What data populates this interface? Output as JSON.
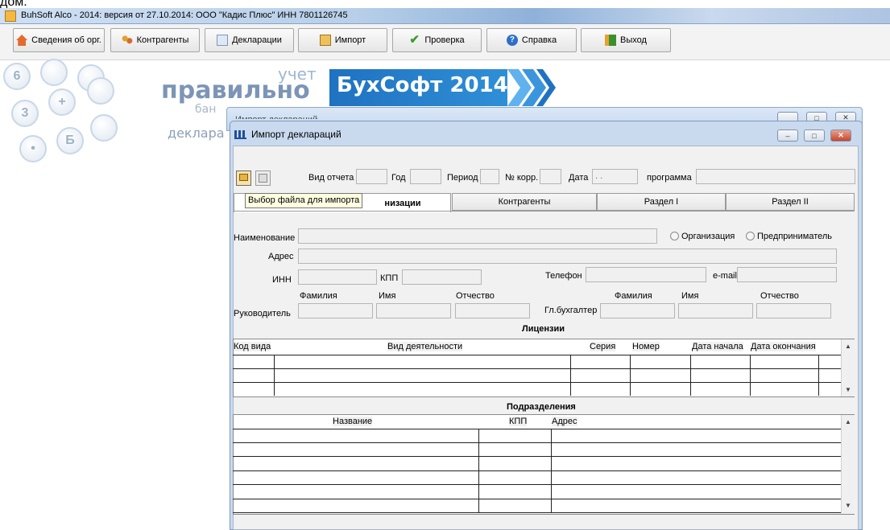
{
  "top_cut_text": "дом.",
  "app": {
    "title": "BuhSoft Alco - 2014: версия от 27.10.2014: ООО \"Кадис Плюс\" ИНН 7801126745"
  },
  "toolbar": {
    "buttons": [
      {
        "label": "Сведения об орг.",
        "icon": "home-icon"
      },
      {
        "label": "Контрагенты",
        "icon": "contacts-icon"
      },
      {
        "label": "Декларации",
        "icon": "document-icon"
      },
      {
        "label": "Импорт",
        "icon": "import-icon"
      },
      {
        "label": "Проверка",
        "icon": "checkmark-icon"
      },
      {
        "label": "Справка",
        "icon": "help-icon"
      },
      {
        "label": "Выход",
        "icon": "exit-icon"
      }
    ]
  },
  "banner": {
    "title": "БухСофт 2014",
    "word1": "правильно",
    "word2": "учет",
    "word3": "бан",
    "word4": "деклара",
    "keys": [
      "6",
      "+",
      "3",
      "Б",
      "•"
    ]
  },
  "bg_window": {
    "title": "Импорт деклараций"
  },
  "dialog": {
    "title": "Импорт деклараций",
    "tooltip": "Выбор файла для импорта",
    "header_fields": {
      "vid_otcheta": "Вид отчета",
      "god": "Год",
      "period": "Период",
      "korr": "№ корр.",
      "data": "Дата",
      "data_value": " . .",
      "programma": "программа"
    },
    "tabs": [
      {
        "label": "низации",
        "active": true
      },
      {
        "label": "Контрагенты",
        "active": false
      },
      {
        "label": "Раздел I",
        "active": false
      },
      {
        "label": "Раздел II",
        "active": false
      }
    ],
    "form": {
      "naimenovanie": "Наименование",
      "adres": "Адрес",
      "inn": "ИНН",
      "kpp": "КПП",
      "telefon": "Телефон",
      "email": "e-mail",
      "familiya": "Фамилия",
      "imya": "Имя",
      "otchestvo": "Отчество",
      "rukovoditel": "Руководитель",
      "glbuh": "Гл.бухгалтер",
      "radio_org": "Организация",
      "radio_ip": "Предприниматель"
    },
    "licenses": {
      "title": "Лицензии",
      "columns": [
        "Код вида",
        "Вид деятельности",
        "Серия",
        "Номер",
        "Дата начала",
        "Дата окончания"
      ]
    },
    "subdivisions": {
      "title": "Подразделения",
      "columns": [
        "Название",
        "КПП",
        "Адрес"
      ]
    }
  },
  "colors": {
    "banner_blue": "#1f72c1",
    "dialog_frame": "#c9daef",
    "close_red": "#c9452b"
  }
}
